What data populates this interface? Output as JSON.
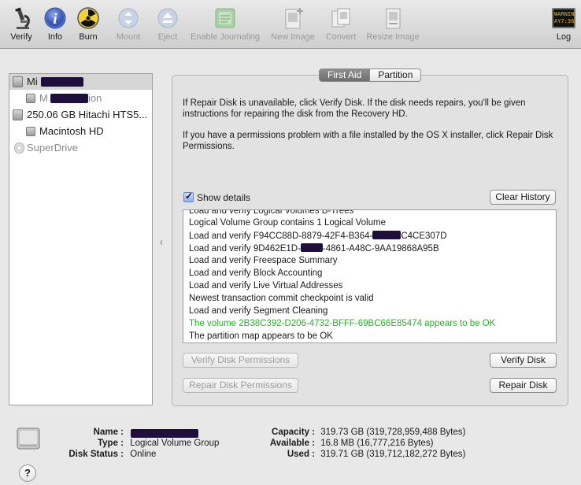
{
  "toolbar": {
    "items": [
      {
        "label": "Verify",
        "icon": "microscope-icon",
        "enabled": true
      },
      {
        "label": "Info",
        "icon": "info-icon",
        "enabled": true
      },
      {
        "label": "Burn",
        "icon": "radiation-icon",
        "enabled": true
      },
      {
        "label": "Mount",
        "icon": "mount-icon",
        "enabled": false
      },
      {
        "label": "Eject",
        "icon": "eject-icon",
        "enabled": false
      },
      {
        "label": "Enable Journaling",
        "icon": "journal-icon",
        "enabled": false
      },
      {
        "label": "New Image",
        "icon": "new-image-icon",
        "enabled": false
      },
      {
        "label": "Convert",
        "icon": "convert-icon",
        "enabled": false
      },
      {
        "label": "Resize Image",
        "icon": "resize-image-icon",
        "enabled": false
      },
      {
        "label": "Log",
        "icon": "log-icon",
        "enabled": true,
        "icon_text_1": "WARNIN",
        "icon_text_2": "AY7:36"
      }
    ]
  },
  "sidebar": {
    "items": [
      {
        "label": "Mi",
        "kind": "volume",
        "selected": true
      },
      {
        "label": "M",
        "label_suffix": "ion",
        "kind": "volume-sub"
      },
      {
        "label": "250.06 GB Hitachi HTS5...",
        "kind": "disk"
      },
      {
        "label": "Macintosh HD",
        "kind": "volume-sub"
      },
      {
        "label": "SuperDrive",
        "kind": "optical"
      }
    ]
  },
  "tabs": {
    "first_aid": "First Aid",
    "partition": "Partition",
    "active": "First Aid"
  },
  "first_aid": {
    "info_1": "If Repair Disk is unavailable, click Verify Disk. If the disk needs repairs, you'll be given instructions for repairing the disk from the Recovery HD.",
    "info_2": "If you have a permissions problem with a file installed by the OS X installer, click Repair Disk Permissions.",
    "show_details_label": "Show details",
    "show_details_checked": true,
    "clear_history": "Clear History",
    "log_lines": [
      {
        "text": "Load and verify Logical Volumes B-Trees",
        "status": "normal"
      },
      {
        "text": "Logical Volume Group contains 1 Logical Volume",
        "status": "normal"
      },
      {
        "text": "Load and verify F94CC88D-8879-42F4-B364-",
        "text_suffix": "C4CE307D",
        "status": "normal"
      },
      {
        "text": "Load and verify 9D462E1D-",
        "text_suffix": "-4861-A48C-9AA19868A95B",
        "status": "normal"
      },
      {
        "text": "Load and verify Freespace Summary",
        "status": "normal"
      },
      {
        "text": "Load and verify Block Accounting",
        "status": "normal"
      },
      {
        "text": "Load and verify Live Virtual Addresses",
        "status": "normal"
      },
      {
        "text": "Newest transaction commit checkpoint is valid",
        "status": "normal"
      },
      {
        "text": "Load and verify Segment Cleaning",
        "status": "normal"
      },
      {
        "text": "The volume 2B38C392-D206-4732-BFFF-69BC66E85474 appears to be OK",
        "status": "ok"
      },
      {
        "text": "The partition map appears to be OK",
        "status": "normal"
      }
    ],
    "verify_permissions": "Verify Disk Permissions",
    "repair_permissions": "Repair Disk Permissions",
    "verify_disk": "Verify Disk",
    "repair_disk": "Repair Disk"
  },
  "details": {
    "name_label": "Name :",
    "name_value": "",
    "type_label": "Type :",
    "type_value": "Logical Volume Group",
    "status_label": "Disk Status :",
    "status_value": "Online",
    "capacity_label": "Capacity :",
    "capacity_value": "319.73 GB (319,728,959,488 Bytes)",
    "available_label": "Available :",
    "available_value": "16.8 MB (16,777,216 Bytes)",
    "used_label": "Used :",
    "used_value": "319.71 GB (319,712,182,272 Bytes)"
  },
  "help": {
    "label": "?"
  },
  "colors": {
    "ok_text": "#26b426",
    "redaction": "#1f0f3d"
  }
}
